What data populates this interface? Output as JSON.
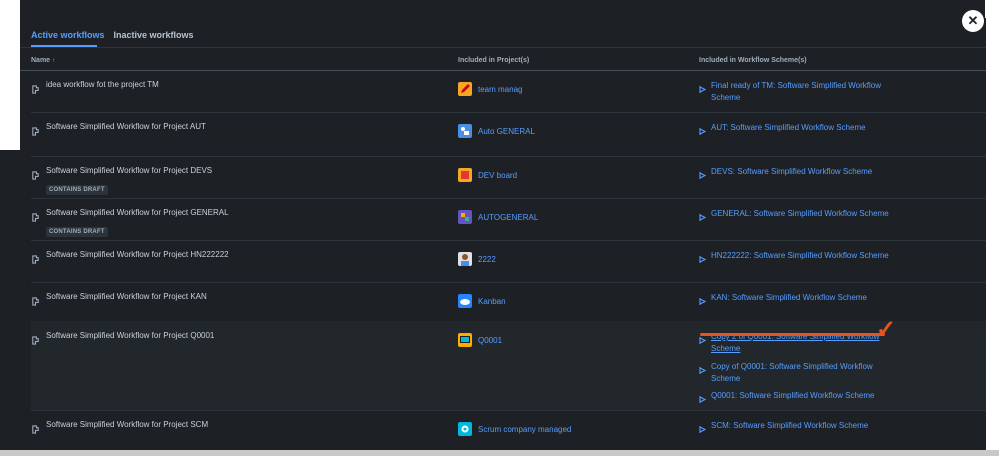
{
  "tabs": {
    "active": "Active workflows",
    "inactive": "Inactive workflows"
  },
  "columns": {
    "name": "Name",
    "sort_indicator": "↑",
    "projects": "Included in Project(s)",
    "schemes": "Included in Workflow Scheme(s)"
  },
  "close_glyph": "✕",
  "draft_badge": "CONTAINS DRAFT",
  "rows": [
    {
      "name": "idea workflow fot the project TM",
      "project": "team manag",
      "avatar": "pencil",
      "schemes": [
        "Final ready of TM: Software Simplified Workflow Scheme"
      ]
    },
    {
      "name": "Software Simplified Workflow for Project AUT",
      "project": "Auto GENERAL",
      "avatar": "tools",
      "schemes": [
        "AUT: Software Simplified Workflow Scheme"
      ]
    },
    {
      "name": "Software Simplified Workflow for Project DEVS",
      "project": "DEV board",
      "avatar": "red-square",
      "draft": true,
      "schemes": [
        "DEVS: Software Simplified Workflow Scheme"
      ]
    },
    {
      "name": "Software Simplified Workflow for Project GENERAL",
      "project": "AUTOGENERAL",
      "avatar": "purple-blocks",
      "draft": true,
      "schemes": [
        "GENERAL: Software Simplified Workflow Scheme"
      ]
    },
    {
      "name": "Software Simplified Workflow for Project HN222222",
      "project": "2222",
      "avatar": "person",
      "schemes": [
        "HN222222: Software Simplified Workflow Scheme"
      ]
    },
    {
      "name": "Software Simplified Workflow for Project KAN",
      "project": "Kanban",
      "avatar": "cloud",
      "schemes": [
        "KAN: Software Simplified Workflow Scheme"
      ]
    },
    {
      "name": "Software Simplified Workflow for Project Q0001",
      "project": "Q0001",
      "avatar": "monitor",
      "schemes": [
        "Copy 2 of Q0001: Software Simplified Workflow Scheme",
        "Copy of Q0001: Software Simplified Workflow Scheme",
        "Q0001: Software Simplified Workflow Scheme"
      ]
    },
    {
      "name": "Software Simplified Workflow for Project SCM",
      "project": "Scrum company managed",
      "avatar": "cog",
      "schemes": [
        "SCM: Software Simplified Workflow Scheme"
      ]
    }
  ],
  "annotation": {
    "checkmark": "✓",
    "color": "#e8531f"
  },
  "colors": {
    "background": "#1d2125",
    "link": "#579dff",
    "text": "#c7d1db"
  }
}
